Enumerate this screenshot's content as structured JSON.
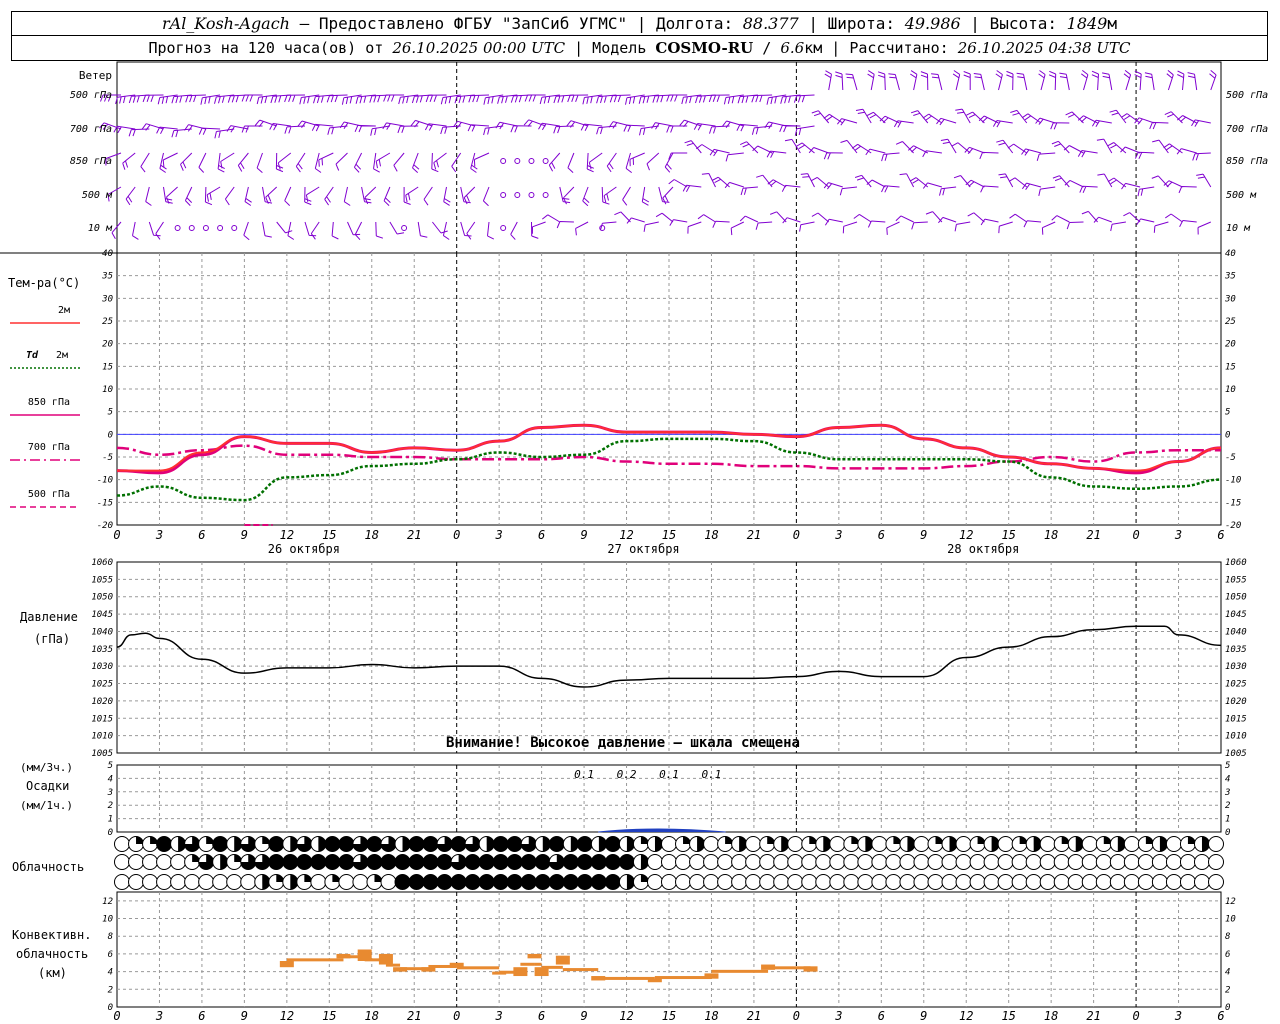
{
  "header": {
    "station": "rAl_Kosh-Agach",
    "provided": " – Предоставлено ФГБУ \"ЗапСиб УГМС\" | Долгота: ",
    "lon": "88.377",
    "lat_label": " | Широта: ",
    "lat": "49.986",
    "alt_label": " | Высота: ",
    "alt": "1849",
    "alt_unit": "м",
    "forecast_label": "Прогноз на 120 часа(ов) от ",
    "forecast_time": "26.10.2025 00:00 UTC",
    "model_label": "  | Модель ",
    "model": "COSMO-RU",
    "res_sep": " / ",
    "res": "6.6",
    "res_unit": "км",
    "calc_label": " | Рассчитано: ",
    "calc_time": "26.10.2025 04:38 UTC"
  },
  "x_axis": {
    "hour_ticks": [
      "0",
      "3",
      "6",
      "9",
      "12",
      "15",
      "18",
      "21",
      "0",
      "3",
      "6",
      "9",
      "12",
      "15",
      "18",
      "21",
      "0",
      "3",
      "6",
      "9",
      "12",
      "15",
      "18",
      "21",
      "0",
      "3",
      "6"
    ],
    "day_labels": [
      "26 октября",
      "27 октября",
      "28 октября"
    ]
  },
  "wind_panel": {
    "title": "Ветер",
    "levels": [
      "500 гПа",
      "700 гПа",
      "850 гПа",
      "500 м",
      "10  м"
    ]
  },
  "temp_panel": {
    "title": "Тем-ра(°C)",
    "legend": [
      {
        "label": "2м",
        "color": "#ff3030",
        "dash": "solid"
      },
      {
        "label": "Td  2м",
        "color": "#007000",
        "dash": "dotted"
      },
      {
        "label": "850 гПа",
        "color": "#e0007a",
        "dash": "solid"
      },
      {
        "label": "700 гПа",
        "color": "#e0007a",
        "dash": "dashdot"
      },
      {
        "label": "500 гПа",
        "color": "#e0007a",
        "dash": "dashed"
      }
    ],
    "y_ticks": [
      "40",
      "35",
      "30",
      "25",
      "20",
      "15",
      "10",
      "5",
      "0",
      "-5",
      "-10",
      "-15",
      "-20"
    ]
  },
  "pressure_panel": {
    "title": "Давление",
    "unit": "(гПа)",
    "y_ticks": [
      "1060",
      "1055",
      "1050",
      "1045",
      "1040",
      "1035",
      "1030",
      "1025",
      "1020",
      "1015",
      "1010",
      "1005"
    ],
    "warning": "Внимание! Высокое давление – шкала смещена"
  },
  "precip_panel": {
    "unit_top": "(мм/3ч.)",
    "title": "Осадки",
    "unit_bottom": "(мм/1ч.)",
    "y_ticks": [
      "5",
      "4",
      "3",
      "2",
      "1",
      "0"
    ],
    "labels": [
      "0.1",
      "0.2",
      "0.1",
      "0.1"
    ]
  },
  "cloud_panel": {
    "title": "Облачность"
  },
  "conv_panel": {
    "title1": "Конвективн.",
    "title2": "облачность",
    "unit": "(км)",
    "y_ticks": [
      "12",
      "10",
      "8",
      "6",
      "4",
      "2",
      "0"
    ]
  },
  "colors": {
    "wind": "#8000d0",
    "t2m": "#ff3030",
    "td2m": "#007000",
    "t850": "#e0007a",
    "pressure": "#000000",
    "precip": "#2040c0",
    "convective": "#e88a30",
    "grid": "#999999",
    "zero_line": "#4040ff"
  },
  "chart_data": [
    {
      "type": "line",
      "title": "Тем-ра(°C)",
      "x_unit": "hours since 26.10.2025 00:00 UTC",
      "ylim": [
        -20,
        40
      ],
      "series": [
        {
          "name": "2м",
          "x": [
            0,
            3,
            6,
            9,
            12,
            15,
            18,
            21,
            24,
            27,
            30,
            33,
            36,
            39,
            42,
            45,
            48,
            51,
            54,
            57,
            60,
            63,
            66,
            69,
            72,
            75,
            78
          ],
          "values": [
            -8,
            -8,
            -4,
            -0.5,
            -2,
            -2,
            -4,
            -3,
            -3.5,
            -1.5,
            1.5,
            2,
            0.5,
            0.5,
            0.5,
            0,
            -0.5,
            1.5,
            2,
            -1,
            -3,
            -5,
            -6.5,
            -7.5,
            -8,
            -6,
            -3
          ]
        },
        {
          "name": "Td  2м",
          "x": [
            0,
            3,
            6,
            9,
            12,
            15,
            18,
            21,
            24,
            27,
            30,
            33,
            36,
            39,
            42,
            45,
            48,
            51,
            54,
            57,
            60,
            63,
            66,
            69,
            72,
            75,
            78
          ],
          "values": [
            -13.5,
            -11.5,
            -14,
            -14.5,
            -9.5,
            -9,
            -7,
            -6.5,
            -5.5,
            -4,
            -5,
            -4.5,
            -1.5,
            -1,
            -1,
            -1.5,
            -4,
            -5.5,
            -5.5,
            -5.5,
            -5.5,
            -6,
            -9.5,
            -11.5,
            -12,
            -11.5,
            -10
          ]
        },
        {
          "name": "850 гПа",
          "x": [
            0,
            3,
            6,
            9,
            12,
            15,
            18,
            21,
            24,
            27,
            30,
            33,
            36,
            39,
            42,
            45,
            48,
            51,
            54,
            57,
            60,
            63,
            66,
            69,
            72,
            75,
            78
          ],
          "values": [
            -8,
            -8.5,
            -4.5,
            -0.5,
            -2,
            -2,
            -4,
            -3,
            -3.5,
            -1.5,
            1.5,
            2,
            0.5,
            0.5,
            0.5,
            0,
            -0.5,
            1.5,
            2,
            -1,
            -3,
            -5,
            -6.5,
            -7.5,
            -8.5,
            -6,
            -3
          ]
        },
        {
          "name": "700 гПа",
          "x": [
            0,
            3,
            6,
            9,
            12,
            15,
            18,
            21,
            24,
            27,
            30,
            33,
            36,
            39,
            42,
            45,
            48,
            51,
            54,
            57,
            60,
            63,
            66,
            69,
            72,
            75,
            78
          ],
          "values": [
            -3,
            -4.5,
            -3.5,
            -2.5,
            -4.5,
            -4.5,
            -5,
            -5,
            -5.5,
            -5.5,
            -5.5,
            -5,
            -6,
            -6.5,
            -6.5,
            -7,
            -7,
            -7.5,
            -7.5,
            -7.5,
            -7,
            -6,
            -5,
            -6,
            -4,
            -3.5,
            -3.5
          ]
        },
        {
          "name": "500 гПа",
          "x": [
            9,
            10,
            11
          ],
          "values": [
            -20,
            -20,
            -20
          ]
        }
      ]
    },
    {
      "type": "line",
      "title": "Давление",
      "ylabel": "(гПа)",
      "ylim": [
        1005,
        1060
      ],
      "series": [
        {
          "name": "Давление",
          "x": [
            0,
            1,
            2,
            3,
            6,
            9,
            12,
            15,
            18,
            21,
            24,
            27,
            30,
            33,
            36,
            39,
            42,
            45,
            48,
            51,
            54,
            57,
            60,
            63,
            66,
            69,
            72,
            74,
            75,
            78
          ],
          "values": [
            1035.5,
            1039,
            1039.5,
            1038,
            1032,
            1028,
            1029.5,
            1029.5,
            1030.5,
            1029.5,
            1030,
            1030,
            1026.5,
            1024,
            1026,
            1026.5,
            1026.5,
            1026.5,
            1027,
            1028.5,
            1027,
            1027,
            1032.5,
            1035.5,
            1038.5,
            1040.5,
            1041.5,
            1041.5,
            1039,
            1036
          ]
        }
      ]
    },
    {
      "type": "bar",
      "title": "Осадки",
      "ylabel": "(мм/3ч.)",
      "ylim": [
        0,
        5
      ],
      "labels_x": [
        33,
        36,
        39,
        42
      ],
      "labels": [
        "0.1",
        "0.2",
        "0.1",
        "0.1"
      ],
      "x": [
        33,
        36,
        39,
        42
      ],
      "values": [
        0.1,
        0.2,
        0.1,
        0.1
      ]
    },
    {
      "type": "bar",
      "title": "Конвективн. облачность",
      "ylabel": "(км)",
      "ylim": [
        0,
        12
      ],
      "ranges_km": [
        {
          "x": 12,
          "bottom": 4.5,
          "top": 5.2
        },
        {
          "x": 16,
          "bottom": 5.5,
          "top": 6
        },
        {
          "x": 17.5,
          "bottom": 5.2,
          "top": 6.5
        },
        {
          "x": 19,
          "bottom": 4.8,
          "top": 6
        },
        {
          "x": 20,
          "bottom": 4,
          "top": 4.5
        },
        {
          "x": 22,
          "bottom": 4,
          "top": 4.5
        },
        {
          "x": 24,
          "bottom": 4.5,
          "top": 5
        },
        {
          "x": 27,
          "bottom": 3.7,
          "top": 4
        },
        {
          "x": 28.5,
          "bottom": 3.5,
          "top": 4.5
        },
        {
          "x": 29.5,
          "bottom": 5.5,
          "top": 6
        },
        {
          "x": 30,
          "bottom": 3.5,
          "top": 4.5
        },
        {
          "x": 31.5,
          "bottom": 4.8,
          "top": 5.8
        },
        {
          "x": 34,
          "bottom": 3,
          "top": 3.5
        },
        {
          "x": 38,
          "bottom": 2.8,
          "top": 3.2
        },
        {
          "x": 42,
          "bottom": 3.2,
          "top": 3.8
        },
        {
          "x": 46,
          "bottom": 4.2,
          "top": 4.8
        },
        {
          "x": 49,
          "bottom": 4,
          "top": 4.6
        }
      ]
    }
  ]
}
